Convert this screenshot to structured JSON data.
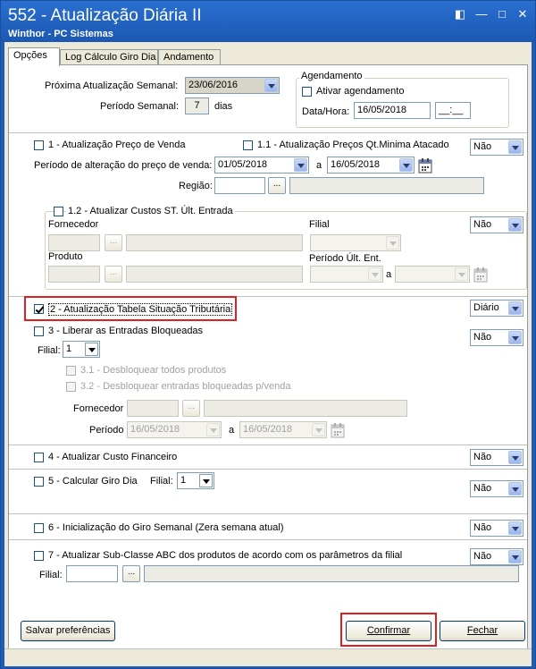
{
  "window": {
    "title": "552 - Atualização Diária II",
    "subtitle": "Winthor - PC Sistemas"
  },
  "tabs": [
    {
      "label": "Opções",
      "active": true
    },
    {
      "label": "Log Cálculo Giro Dia"
    },
    {
      "label": "Andamento"
    }
  ],
  "semanal": {
    "prox_label": "Próxima Atualização Semanal:",
    "prox_value": "23/06/2016",
    "periodo_label": "Período Semanal:",
    "periodo_value": "7",
    "periodo_unit": "dias"
  },
  "agendamento": {
    "title": "Agendamento",
    "ativar_label": "Ativar agendamento",
    "datahora_label": "Data/Hora:",
    "date_value": "16/05/2018",
    "time_value": "__:__"
  },
  "s1": {
    "label": "1 - Atualização Preço de Venda",
    "label_11": "1.1 - Atualização Preços Qt.Minima Atacado",
    "select": "Não",
    "periodo_label": "Período de alteração do preço de venda:",
    "from": "01/05/2018",
    "a": "a",
    "to": "16/05/2018",
    "regiao_label": "Região:",
    "ellipsis": "..."
  },
  "s12": {
    "label": "1.2 - Atualizar Custos ST. Últ. Entrada",
    "fornecedor_label": "Fornecedor",
    "filial_label": "Filial",
    "select": "Não",
    "produto_label": "Produto",
    "periodo_label": "Período Últ. Ent.",
    "a": "a",
    "ellipsis": "..."
  },
  "s2": {
    "label": "2 - Atualização Tabela Situação Tributária",
    "select": "Diário",
    "checked": true
  },
  "s3": {
    "label": "3 - Liberar as Entradas Bloqueadas",
    "select": "Não",
    "filial_label": "Filial:",
    "filial_value": "1",
    "opt31": "3.1 - Desbloquear todos produtos",
    "opt32": "3.2 - Desbloquear entradas bloqueadas p/venda",
    "fornecedor_label": "Fornecedor",
    "ellipsis": "...",
    "periodo_label": "Período",
    "from": "16/05/2018",
    "a": "a",
    "to": "16/05/2018"
  },
  "s4": {
    "label": "4 - Atualizar Custo Financeiro",
    "select": "Não"
  },
  "s5": {
    "label": "5 - Calcular Giro Dia",
    "filial_label": "Filial:",
    "filial_value": "1",
    "select": "Não"
  },
  "s6": {
    "label": "6 - Inicialização do Giro Semanal (Zera semana atual)",
    "select": "Não"
  },
  "s7": {
    "label": "7 - Atualizar Sub-Classe ABC dos produtos de acordo com os parâmetros da filial",
    "select": "Não",
    "filial_label": "Filial:",
    "ellipsis": "..."
  },
  "buttons": {
    "salvar": "Salvar preferências",
    "confirmar": "Confirmar",
    "fechar": "Fechar"
  },
  "colors": {
    "title_bar": "#1e5cb8",
    "highlight": "#e02020",
    "face": "#ece9d8"
  }
}
